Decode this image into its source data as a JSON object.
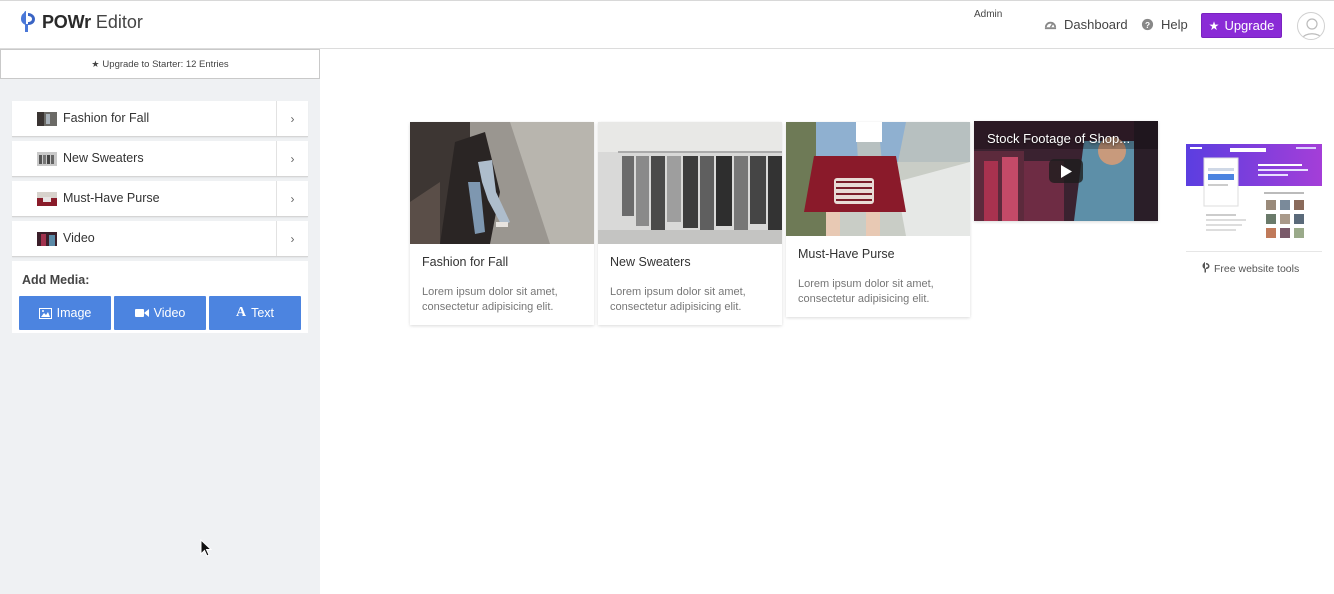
{
  "header": {
    "brand": "POWr",
    "product": "Editor",
    "admin_label": "Admin",
    "dashboard_label": "Dashboard",
    "help_label": "Help",
    "upgrade_label": "Upgrade",
    "accent_color": "#8a2bd6"
  },
  "sidebar": {
    "upgrade_notice": "Upgrade to Starter: 12 Entries",
    "entries": [
      {
        "label": "Fashion for Fall"
      },
      {
        "label": "New Sweaters"
      },
      {
        "label": "Must-Have Purse"
      },
      {
        "label": "Video"
      }
    ],
    "add_media_title": "Add Media:",
    "media_buttons": {
      "image": "Image",
      "video": "Video",
      "text": "Text"
    },
    "button_color": "#4c84e0"
  },
  "gallery": {
    "cards": [
      {
        "title": "Fashion for Fall",
        "description": "Lorem ipsum dolor sit amet, consectetur adipisicing elit."
      },
      {
        "title": "New Sweaters",
        "description": "Lorem ipsum dolor sit amet, consectetur adipisicing elit."
      },
      {
        "title": "Must-Have Purse",
        "description": "Lorem ipsum dolor sit amet, consectetur adipisicing elit."
      }
    ],
    "video": {
      "title": "Stock Footage of Shop..."
    }
  },
  "promo": {
    "link_label": "Free website tools"
  }
}
